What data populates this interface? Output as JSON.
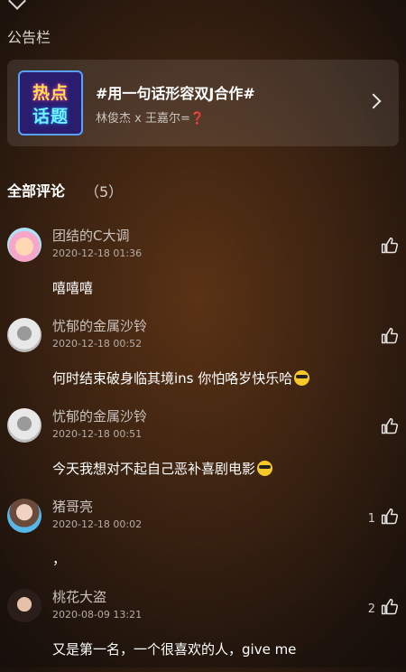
{
  "announcement": {
    "label": "公告栏",
    "thumb_line1": "热点",
    "thumb_line2": "话题",
    "title": "#用一句话形容双J合作#",
    "subtitle": "林俊杰 x 王嘉尔=",
    "subtitle_mark": "❓"
  },
  "comments_header": {
    "label": "全部评论",
    "count": "（5）"
  },
  "comments": [
    {
      "user": "团结的C大调",
      "time": "2020-12-18 01:36",
      "text": "嘻嘻嘻",
      "likes": ""
    },
    {
      "user": "忧郁的金属沙铃",
      "time": "2020-12-18 00:52",
      "text": "何时结束破身临其境ins 你怕咯岁快乐哈",
      "likes": ""
    },
    {
      "user": "忧郁的金属沙铃",
      "time": "2020-12-18 00:51",
      "text": "今天我想对不起自己恶补喜剧电影",
      "likes": ""
    },
    {
      "user": "猪哥亮",
      "time": "2020-12-18 00:02",
      "text": "，",
      "likes": "1"
    },
    {
      "user": "桃花大盗",
      "time": "2020-08-09 13:21",
      "text": "又是第一名，一个很喜欢的人，give me",
      "likes": "2"
    }
  ],
  "icons": {
    "back": "chevron-down-icon",
    "open": "chevron-right-icon",
    "like": "thumbs-up-icon",
    "emoji": "cool-face-emoji"
  }
}
